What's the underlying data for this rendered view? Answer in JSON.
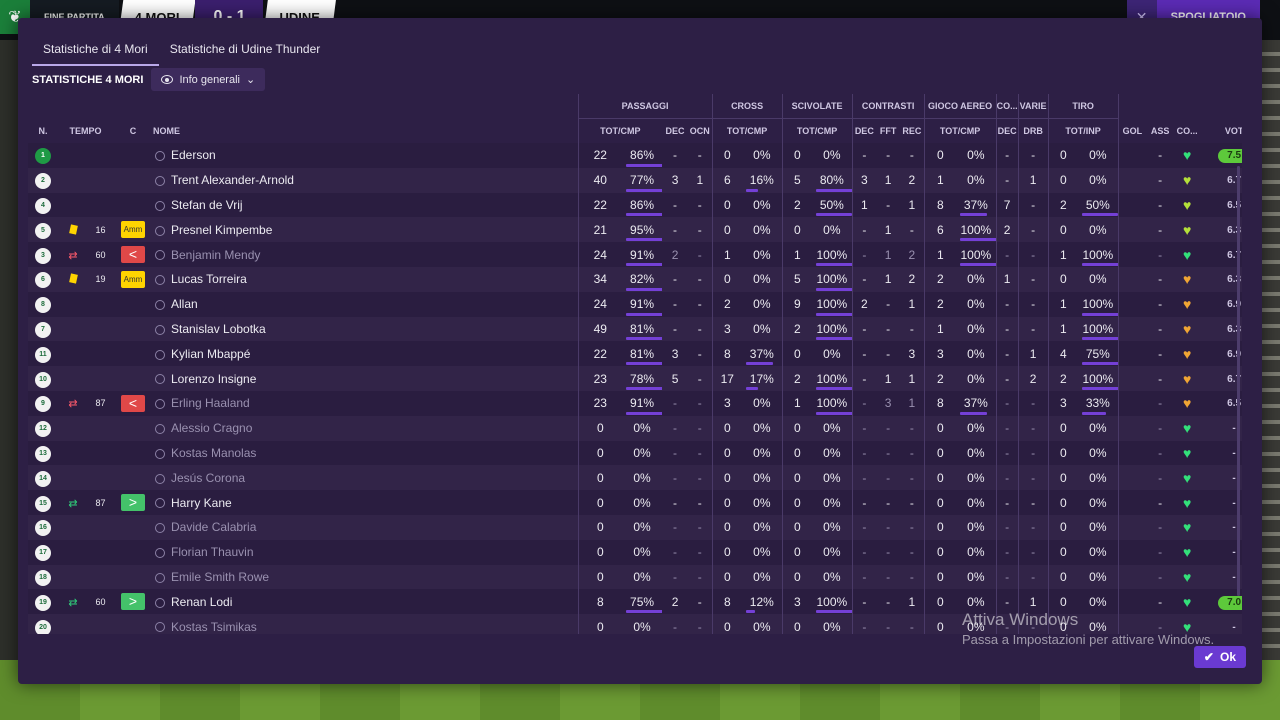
{
  "scoreboard": {
    "logo_icon": "competition-logo",
    "label": "FINE PARTITA",
    "home": "4 MORI",
    "score": "0 - 1",
    "away": "UDINE",
    "action": "SPOGLIATOIO"
  },
  "tabs": [
    "Statistiche di 4 Mori",
    "Statistiche di Udine Thunder"
  ],
  "subtitle": "STATISTICHE 4 MORI",
  "view": "Info generali",
  "groups": {
    "passaggi": "PASSAGGI",
    "cross": "CROSS",
    "scivolate": "SCIVOLATE",
    "contrasti": "CONTRASTI",
    "aereo": "GIOCO AEREO",
    "co": "CO...",
    "varie": "VARIE",
    "tiro": "TIRO"
  },
  "columns": {
    "n": "N.",
    "tempo": "TEMPO",
    "c": "C",
    "nome": "NOME",
    "totcmp": "TOT/CMP",
    "dec": "DEC",
    "ocn": "OCN",
    "fft": "FFT",
    "rec": "REC",
    "drb": "DRB",
    "totinp": "TOT/INP",
    "gol": "GOL",
    "ass": "ASS",
    "co": "CO...",
    "vot": "VOT"
  },
  "colors": {
    "accent": "#7440d6",
    "rating_top": "#5dc93b",
    "heart_green": "#33e07a",
    "heart_lime": "#b4e03a",
    "heart_orange": "#f0a534"
  },
  "players": [
    {
      "n": "1",
      "tempo": "",
      "card": "",
      "cbadge": "",
      "name": "Ederson",
      "dim": false,
      "pt": "22",
      "pp": "86%",
      "pb": 0.86,
      "pd": "-",
      "po": "-",
      "ct": "0",
      "cp": "0%",
      "cb": 0,
      "st": "0",
      "sp": "0%",
      "sb": 0,
      "kd": "-",
      "kf": "-",
      "kr": "-",
      "at": "0",
      "ap": "0%",
      "ab": 0,
      "co": "-",
      "drb": "-",
      "tt": "0",
      "tp": "0%",
      "tb": 0,
      "gol": "",
      "ass": "-",
      "heart": "green",
      "vot": "7.5",
      "top": true
    },
    {
      "n": "2",
      "tempo": "",
      "card": "",
      "cbadge": "",
      "name": "Trent Alexander-Arnold",
      "dim": false,
      "pt": "40",
      "pp": "77%",
      "pb": 0.77,
      "pd": "3",
      "po": "1",
      "ct": "6",
      "cp": "16%",
      "cb": 0.16,
      "st": "5",
      "sp": "80%",
      "sb": 0.8,
      "kd": "3",
      "kf": "1",
      "kr": "2",
      "at": "1",
      "ap": "0%",
      "ab": 0,
      "co": "-",
      "drb": "1",
      "tt": "0",
      "tp": "0%",
      "tb": 0,
      "gol": "",
      "ass": "-",
      "heart": "lime",
      "vot": "6.7",
      "top": false
    },
    {
      "n": "4",
      "tempo": "",
      "card": "",
      "cbadge": "",
      "name": "Stefan de Vrij",
      "dim": false,
      "pt": "22",
      "pp": "86%",
      "pb": 0.86,
      "pd": "-",
      "po": "-",
      "ct": "0",
      "cp": "0%",
      "cb": 0,
      "st": "2",
      "sp": "50%",
      "sb": 0.5,
      "kd": "1",
      "kf": "-",
      "kr": "1",
      "at": "8",
      "ap": "37%",
      "ab": 0.37,
      "co": "7",
      "drb": "-",
      "tt": "2",
      "tp": "50%",
      "tb": 0.5,
      "gol": "",
      "ass": "-",
      "heart": "lime",
      "vot": "6.5",
      "top": false
    },
    {
      "n": "5",
      "tempo": "16",
      "card": "yellow",
      "cbadge": "Amm",
      "name": "Presnel Kimpembe",
      "dim": false,
      "pt": "21",
      "pp": "95%",
      "pb": 0.95,
      "pd": "-",
      "po": "-",
      "ct": "0",
      "cp": "0%",
      "cb": 0,
      "st": "0",
      "sp": "0%",
      "sb": 0,
      "kd": "-",
      "kf": "1",
      "kr": "-",
      "at": "6",
      "ap": "100%",
      "ab": 1,
      "co": "2",
      "drb": "-",
      "tt": "0",
      "tp": "0%",
      "tb": 0,
      "gol": "",
      "ass": "-",
      "heart": "lime",
      "vot": "6.3",
      "top": false
    },
    {
      "n": "3",
      "tempo": "60",
      "card": "sub-out",
      "cbadge": "<",
      "name": "Benjamin Mendy",
      "dim": true,
      "pt": "24",
      "pp": "91%",
      "pb": 0.91,
      "pd": "2",
      "po": "-",
      "ct": "1",
      "cp": "0%",
      "cb": 0,
      "st": "1",
      "sp": "100%",
      "sb": 1,
      "kd": "-",
      "kf": "1",
      "kr": "2",
      "at": "1",
      "ap": "100%",
      "ab": 1,
      "co": "-",
      "drb": "-",
      "tt": "1",
      "tp": "100%",
      "tb": 1,
      "gol": "",
      "ass": "-",
      "heart": "green",
      "vot": "6.7",
      "top": false
    },
    {
      "n": "6",
      "tempo": "19",
      "card": "yellow",
      "cbadge": "Amm",
      "name": "Lucas Torreira",
      "dim": false,
      "pt": "34",
      "pp": "82%",
      "pb": 0.82,
      "pd": "-",
      "po": "-",
      "ct": "0",
      "cp": "0%",
      "cb": 0,
      "st": "5",
      "sp": "100%",
      "sb": 1,
      "kd": "-",
      "kf": "1",
      "kr": "2",
      "at": "2",
      "ap": "0%",
      "ab": 0,
      "co": "1",
      "drb": "-",
      "tt": "0",
      "tp": "0%",
      "tb": 0,
      "gol": "",
      "ass": "-",
      "heart": "orange",
      "vot": "6.3",
      "top": false
    },
    {
      "n": "8",
      "tempo": "",
      "card": "",
      "cbadge": "",
      "name": "Allan",
      "dim": false,
      "pt": "24",
      "pp": "91%",
      "pb": 0.91,
      "pd": "-",
      "po": "-",
      "ct": "2",
      "cp": "0%",
      "cb": 0,
      "st": "9",
      "sp": "100%",
      "sb": 1,
      "kd": "2",
      "kf": "-",
      "kr": "1",
      "at": "2",
      "ap": "0%",
      "ab": 0,
      "co": "-",
      "drb": "-",
      "tt": "1",
      "tp": "100%",
      "tb": 1,
      "gol": "",
      "ass": "-",
      "heart": "orange",
      "vot": "6.9",
      "top": false
    },
    {
      "n": "7",
      "tempo": "",
      "card": "",
      "cbadge": "",
      "name": "Stanislav Lobotka",
      "dim": false,
      "pt": "49",
      "pp": "81%",
      "pb": 0.81,
      "pd": "-",
      "po": "-",
      "ct": "3",
      "cp": "0%",
      "cb": 0,
      "st": "2",
      "sp": "100%",
      "sb": 1,
      "kd": "-",
      "kf": "-",
      "kr": "-",
      "at": "1",
      "ap": "0%",
      "ab": 0,
      "co": "-",
      "drb": "-",
      "tt": "1",
      "tp": "100%",
      "tb": 1,
      "gol": "",
      "ass": "-",
      "heart": "orange",
      "vot": "6.3",
      "top": false
    },
    {
      "n": "11",
      "tempo": "",
      "card": "",
      "cbadge": "",
      "name": "Kylian Mbappé",
      "dim": false,
      "pt": "22",
      "pp": "81%",
      "pb": 0.81,
      "pd": "3",
      "po": "-",
      "ct": "8",
      "cp": "37%",
      "cb": 0.37,
      "st": "0",
      "sp": "0%",
      "sb": 0,
      "kd": "-",
      "kf": "-",
      "kr": "3",
      "at": "3",
      "ap": "0%",
      "ab": 0,
      "co": "-",
      "drb": "1",
      "tt": "4",
      "tp": "75%",
      "tb": 0.75,
      "gol": "",
      "ass": "-",
      "heart": "orange",
      "vot": "6.9",
      "top": false
    },
    {
      "n": "10",
      "tempo": "",
      "card": "",
      "cbadge": "",
      "name": "Lorenzo Insigne",
      "dim": false,
      "pt": "23",
      "pp": "78%",
      "pb": 0.78,
      "pd": "5",
      "po": "-",
      "ct": "17",
      "cp": "17%",
      "cb": 0.17,
      "st": "2",
      "sp": "100%",
      "sb": 1,
      "kd": "-",
      "kf": "1",
      "kr": "1",
      "at": "2",
      "ap": "0%",
      "ab": 0,
      "co": "-",
      "drb": "2",
      "tt": "2",
      "tp": "100%",
      "tb": 1,
      "gol": "",
      "ass": "-",
      "heart": "orange",
      "vot": "6.7",
      "top": false
    },
    {
      "n": "9",
      "tempo": "87",
      "card": "sub-out",
      "cbadge": "<",
      "name": "Erling Haaland",
      "dim": true,
      "pt": "23",
      "pp": "91%",
      "pb": 0.91,
      "pd": "-",
      "po": "-",
      "ct": "3",
      "cp": "0%",
      "cb": 0,
      "st": "1",
      "sp": "100%",
      "sb": 1,
      "kd": "-",
      "kf": "3",
      "kr": "1",
      "at": "8",
      "ap": "37%",
      "ab": 0.37,
      "co": "-",
      "drb": "-",
      "tt": "3",
      "tp": "33%",
      "tb": 0.33,
      "gol": "",
      "ass": "-",
      "heart": "orange",
      "vot": "6.5",
      "top": false
    },
    {
      "n": "12",
      "tempo": "",
      "card": "",
      "cbadge": "",
      "name": "Alessio Cragno",
      "dim": true,
      "pt": "0",
      "pp": "0%",
      "pb": 0,
      "pd": "-",
      "po": "-",
      "ct": "0",
      "cp": "0%",
      "cb": 0,
      "st": "0",
      "sp": "0%",
      "sb": 0,
      "kd": "-",
      "kf": "-",
      "kr": "-",
      "at": "0",
      "ap": "0%",
      "ab": 0,
      "co": "-",
      "drb": "-",
      "tt": "0",
      "tp": "0%",
      "tb": 0,
      "gol": "",
      "ass": "-",
      "heart": "green",
      "vot": "-",
      "top": false
    },
    {
      "n": "13",
      "tempo": "",
      "card": "",
      "cbadge": "",
      "name": "Kostas Manolas",
      "dim": true,
      "pt": "0",
      "pp": "0%",
      "pb": 0,
      "pd": "-",
      "po": "-",
      "ct": "0",
      "cp": "0%",
      "cb": 0,
      "st": "0",
      "sp": "0%",
      "sb": 0,
      "kd": "-",
      "kf": "-",
      "kr": "-",
      "at": "0",
      "ap": "0%",
      "ab": 0,
      "co": "-",
      "drb": "-",
      "tt": "0",
      "tp": "0%",
      "tb": 0,
      "gol": "",
      "ass": "-",
      "heart": "green",
      "vot": "-",
      "top": false
    },
    {
      "n": "14",
      "tempo": "",
      "card": "",
      "cbadge": "",
      "name": "Jesús Corona",
      "dim": true,
      "pt": "0",
      "pp": "0%",
      "pb": 0,
      "pd": "-",
      "po": "-",
      "ct": "0",
      "cp": "0%",
      "cb": 0,
      "st": "0",
      "sp": "0%",
      "sb": 0,
      "kd": "-",
      "kf": "-",
      "kr": "-",
      "at": "0",
      "ap": "0%",
      "ab": 0,
      "co": "-",
      "drb": "-",
      "tt": "0",
      "tp": "0%",
      "tb": 0,
      "gol": "",
      "ass": "-",
      "heart": "green",
      "vot": "-",
      "top": false
    },
    {
      "n": "15",
      "tempo": "87",
      "card": "sub-in",
      "cbadge": ">",
      "name": "Harry Kane",
      "dim": false,
      "pt": "0",
      "pp": "0%",
      "pb": 0,
      "pd": "-",
      "po": "-",
      "ct": "0",
      "cp": "0%",
      "cb": 0,
      "st": "0",
      "sp": "0%",
      "sb": 0,
      "kd": "-",
      "kf": "-",
      "kr": "-",
      "at": "0",
      "ap": "0%",
      "ab": 0,
      "co": "-",
      "drb": "-",
      "tt": "0",
      "tp": "0%",
      "tb": 0,
      "gol": "",
      "ass": "-",
      "heart": "green",
      "vot": "-",
      "top": false
    },
    {
      "n": "16",
      "tempo": "",
      "card": "",
      "cbadge": "",
      "name": "Davide Calabria",
      "dim": true,
      "pt": "0",
      "pp": "0%",
      "pb": 0,
      "pd": "-",
      "po": "-",
      "ct": "0",
      "cp": "0%",
      "cb": 0,
      "st": "0",
      "sp": "0%",
      "sb": 0,
      "kd": "-",
      "kf": "-",
      "kr": "-",
      "at": "0",
      "ap": "0%",
      "ab": 0,
      "co": "-",
      "drb": "-",
      "tt": "0",
      "tp": "0%",
      "tb": 0,
      "gol": "",
      "ass": "-",
      "heart": "green",
      "vot": "-",
      "top": false
    },
    {
      "n": "17",
      "tempo": "",
      "card": "",
      "cbadge": "",
      "name": "Florian Thauvin",
      "dim": true,
      "pt": "0",
      "pp": "0%",
      "pb": 0,
      "pd": "-",
      "po": "-",
      "ct": "0",
      "cp": "0%",
      "cb": 0,
      "st": "0",
      "sp": "0%",
      "sb": 0,
      "kd": "-",
      "kf": "-",
      "kr": "-",
      "at": "0",
      "ap": "0%",
      "ab": 0,
      "co": "-",
      "drb": "-",
      "tt": "0",
      "tp": "0%",
      "tb": 0,
      "gol": "",
      "ass": "-",
      "heart": "green",
      "vot": "-",
      "top": false
    },
    {
      "n": "18",
      "tempo": "",
      "card": "",
      "cbadge": "",
      "name": "Emile Smith Rowe",
      "dim": true,
      "pt": "0",
      "pp": "0%",
      "pb": 0,
      "pd": "-",
      "po": "-",
      "ct": "0",
      "cp": "0%",
      "cb": 0,
      "st": "0",
      "sp": "0%",
      "sb": 0,
      "kd": "-",
      "kf": "-",
      "kr": "-",
      "at": "0",
      "ap": "0%",
      "ab": 0,
      "co": "-",
      "drb": "-",
      "tt": "0",
      "tp": "0%",
      "tb": 0,
      "gol": "",
      "ass": "-",
      "heart": "green",
      "vot": "-",
      "top": false
    },
    {
      "n": "19",
      "tempo": "60",
      "card": "sub-in",
      "cbadge": ">",
      "name": "Renan Lodi",
      "dim": false,
      "pt": "8",
      "pp": "75%",
      "pb": 0.75,
      "pd": "2",
      "po": "-",
      "ct": "8",
      "cp": "12%",
      "cb": 0.12,
      "st": "3",
      "sp": "100%",
      "sb": 1,
      "kd": "-",
      "kf": "-",
      "kr": "1",
      "at": "0",
      "ap": "0%",
      "ab": 0,
      "co": "-",
      "drb": "1",
      "tt": "0",
      "tp": "0%",
      "tb": 0,
      "gol": "",
      "ass": "-",
      "heart": "green",
      "vot": "7.0",
      "top": true
    },
    {
      "n": "20",
      "tempo": "",
      "card": "",
      "cbadge": "",
      "name": "Kostas Tsimikas",
      "dim": true,
      "pt": "0",
      "pp": "0%",
      "pb": 0,
      "pd": "-",
      "po": "-",
      "ct": "0",
      "cp": "0%",
      "cb": 0,
      "st": "0",
      "sp": "0%",
      "sb": 0,
      "kd": "-",
      "kf": "-",
      "kr": "-",
      "at": "0",
      "ap": "0%",
      "ab": 0,
      "co": "-",
      "drb": "-",
      "tt": "0",
      "tp": "0%",
      "tb": 0,
      "gol": "",
      "ass": "-",
      "heart": "green",
      "vot": "-",
      "top": false
    }
  ],
  "ok_label": "Ok",
  "watermark": {
    "line1": "Attiva Windows",
    "line2": "Passa a Impostazioni per attivare Windows."
  }
}
